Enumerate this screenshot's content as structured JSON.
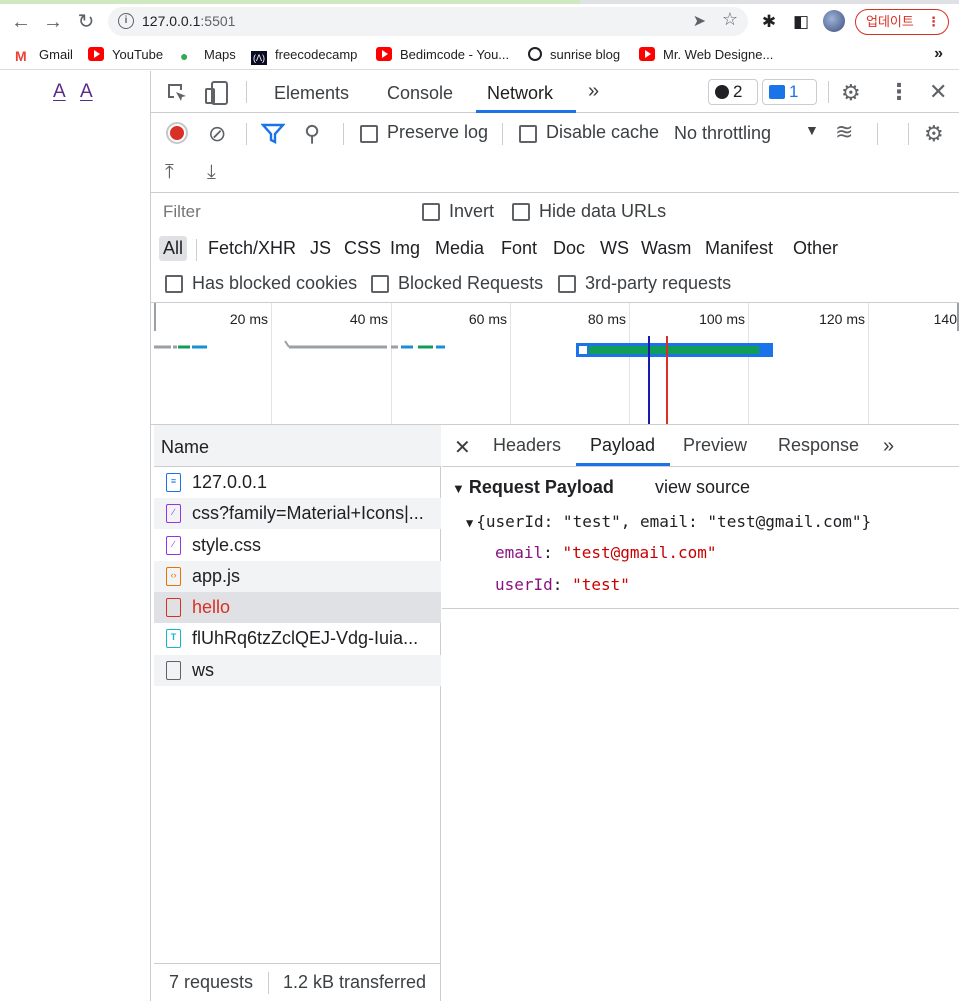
{
  "browser": {
    "url_host": "127.0.0.1",
    "url_port": ":5501",
    "update_label": "업데이트",
    "bookmarks": [
      {
        "label": "Gmail",
        "icon": "gmail-icon"
      },
      {
        "label": "YouTube",
        "icon": "youtube-icon"
      },
      {
        "label": "Maps",
        "icon": "maps-icon"
      },
      {
        "label": "freecodecamp",
        "icon": "freecodecamp-icon"
      },
      {
        "label": "Bedimcode - You...",
        "icon": "youtube-icon"
      },
      {
        "label": "sunrise blog",
        "icon": "globe-icon"
      },
      {
        "label": "Mr. Web Designe...",
        "icon": "youtube-icon"
      }
    ]
  },
  "page": {
    "links": [
      "A",
      "A"
    ]
  },
  "devtools": {
    "tabs": [
      "Elements",
      "Console",
      "Network"
    ],
    "active_tab": "Network",
    "errors_count": "2",
    "messages_count": "1",
    "toolbar": {
      "preserve_log": "Preserve log",
      "disable_cache": "Disable cache",
      "throttling": "No throttling"
    },
    "filter": {
      "placeholder": "Filter",
      "invert": "Invert",
      "hide_data_urls": "Hide data URLs",
      "types": [
        "All",
        "Fetch/XHR",
        "JS",
        "CSS",
        "Img",
        "Media",
        "Font",
        "Doc",
        "WS",
        "Wasm",
        "Manifest",
        "Other"
      ],
      "has_blocked_cookies": "Has blocked cookies",
      "blocked_requests": "Blocked Requests",
      "third_party": "3rd-party requests"
    },
    "timeline": {
      "ticks": [
        "20 ms",
        "40 ms",
        "60 ms",
        "80 ms",
        "100 ms",
        "120 ms",
        "140"
      ]
    },
    "requests": {
      "column": "Name",
      "rows": [
        {
          "name": "127.0.0.1",
          "type": "doc",
          "color": "#1a73e8"
        },
        {
          "name": "css?family=Material+Icons|...",
          "type": "css",
          "color": "#9334e6"
        },
        {
          "name": "style.css",
          "type": "css",
          "color": "#9334e6"
        },
        {
          "name": "app.js",
          "type": "js",
          "color": "#e37400"
        },
        {
          "name": "hello",
          "type": "failed",
          "color": "#d93025"
        },
        {
          "name": "flUhRq6tzZclQEJ-Vdg-Iuia...",
          "type": "font",
          "color": "#12b5cb"
        },
        {
          "name": "ws",
          "type": "other",
          "color": "#5f6368"
        }
      ],
      "summary_count": "7 requests",
      "summary_transferred": "1.2 kB transferred"
    },
    "detail": {
      "tabs": [
        "Headers",
        "Payload",
        "Preview",
        "Response"
      ],
      "active_tab": "Payload",
      "section_title": "Request Payload",
      "view_source": "view source",
      "summary_line": "{userId: \"test\", email: \"test@gmail.com\"}",
      "fields": [
        {
          "key": "email",
          "value": "\"test@gmail.com\""
        },
        {
          "key": "userId",
          "value": "\"test\""
        }
      ]
    }
  }
}
